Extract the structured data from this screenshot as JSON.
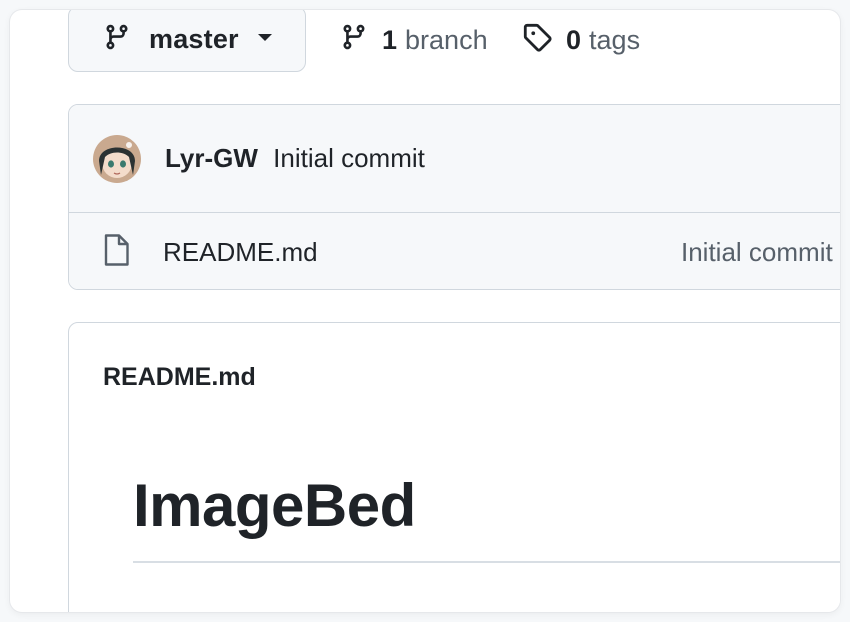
{
  "branch_selector": {
    "label": "master"
  },
  "branches": {
    "count": "1",
    "label": "branch"
  },
  "tags": {
    "count": "0",
    "label": "tags"
  },
  "latest_commit": {
    "author": "Lyr-GW",
    "message": "Initial commit"
  },
  "files": [
    {
      "name": "README.md",
      "icon": "file-icon",
      "commit_message": "Initial commit"
    }
  ],
  "readme": {
    "header": "README.md",
    "title": "ImageBed"
  }
}
